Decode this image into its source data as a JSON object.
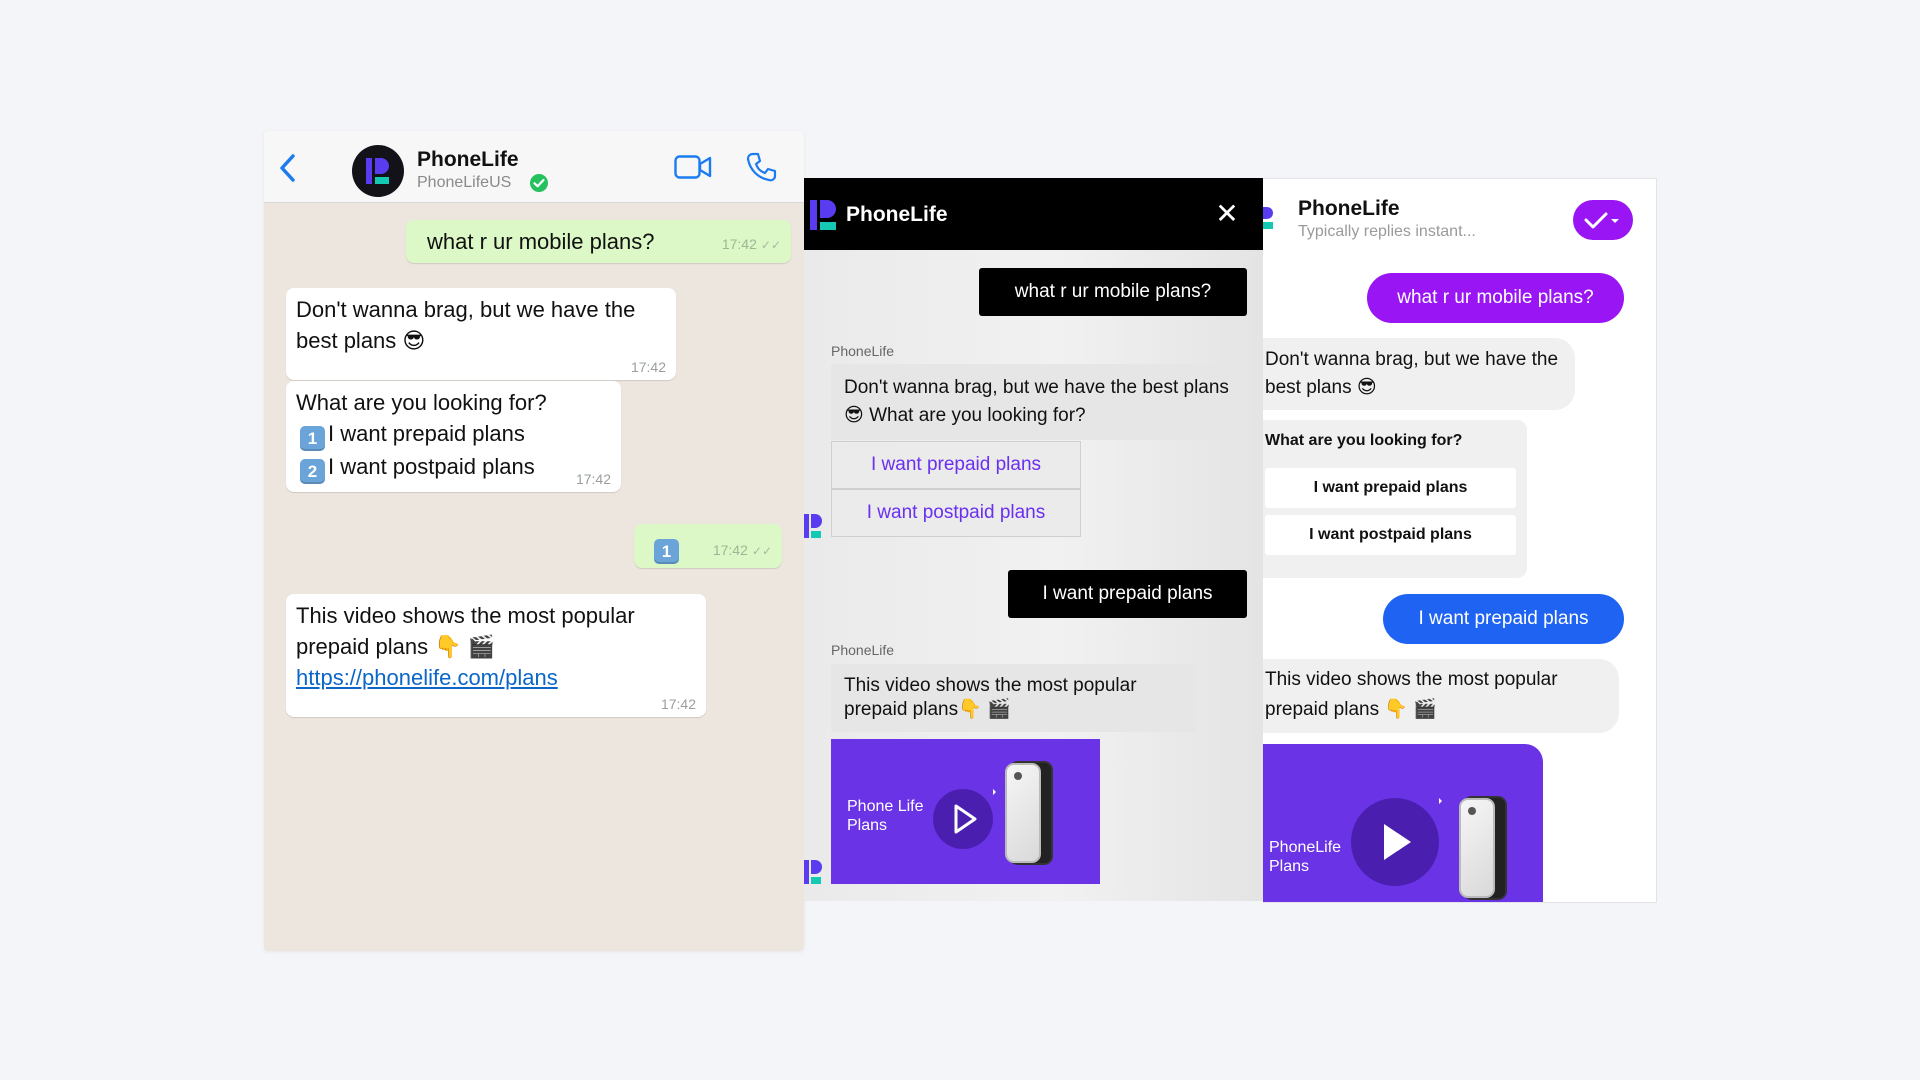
{
  "whatsapp": {
    "contact_name": "PhoneLife",
    "contact_handle": "PhoneLifeUS",
    "messages": [
      {
        "text": "what r ur mobile plans?",
        "time": "17:42"
      },
      {
        "text": "Don't wanna brag, but we have the best plans 😎",
        "time": "17:42"
      },
      {
        "line1": "What are you looking for?",
        "opt1_key": "1",
        "opt1": "I want prepaid plans",
        "opt2_key": "2",
        "opt2": "I want postpaid plans",
        "time": "17:42"
      },
      {
        "key": "1",
        "time": "17:42"
      },
      {
        "text": "This video shows the most popular prepaid plans 👇 🎬",
        "link": "https://phonelife.com/plans",
        "time": "17:42"
      }
    ]
  },
  "webchat": {
    "title": "PhoneLife",
    "close_label": "✕",
    "user_msg_1": "what r ur mobile plans?",
    "sender_1": "PhoneLife",
    "bot_msg_1": "Don't wanna brag, but we have the best plans 😎 What are you looking for?",
    "buttons": [
      "I want prepaid plans",
      "I want postpaid plans"
    ],
    "user_msg_2": "I want prepaid plans",
    "sender_2": "PhoneLife",
    "bot_msg_2": "This video shows the most popular prepaid plans👇 🎬",
    "video_label_1": "Phone Life",
    "video_label_2": "Plans"
  },
  "messenger": {
    "name": "PhoneLife",
    "status": "Typically replies instant...",
    "user_msg_1": "what r ur mobile plans?",
    "bot_msg_1": "Don't wanna brag, but we have the best plans 😎",
    "question": "What are you looking for?",
    "buttons": [
      "I want prepaid plans",
      "I want postpaid plans"
    ],
    "user_msg_2": "I want prepaid plans",
    "bot_msg_2": "This video shows the most popular prepaid plans 👇 🎬",
    "video_label_1": "PhoneLife",
    "video_label_2": "Plans"
  },
  "colors": {
    "whatsapp_outgoing": "#dcf8c6",
    "whatsapp_background": "#ece6df",
    "ios_blue": "#1a7cf0",
    "brand_purple": "#6b33e6",
    "messenger_purple": "#9a15f4",
    "messenger_blue": "#1f63f2",
    "button_text_purple": "#6a2ff0"
  },
  "icons": [
    "back-chevron-icon",
    "verified-icon",
    "video-call-icon",
    "phone-call-icon",
    "close-icon",
    "check-dropdown-icon",
    "play-icon"
  ]
}
